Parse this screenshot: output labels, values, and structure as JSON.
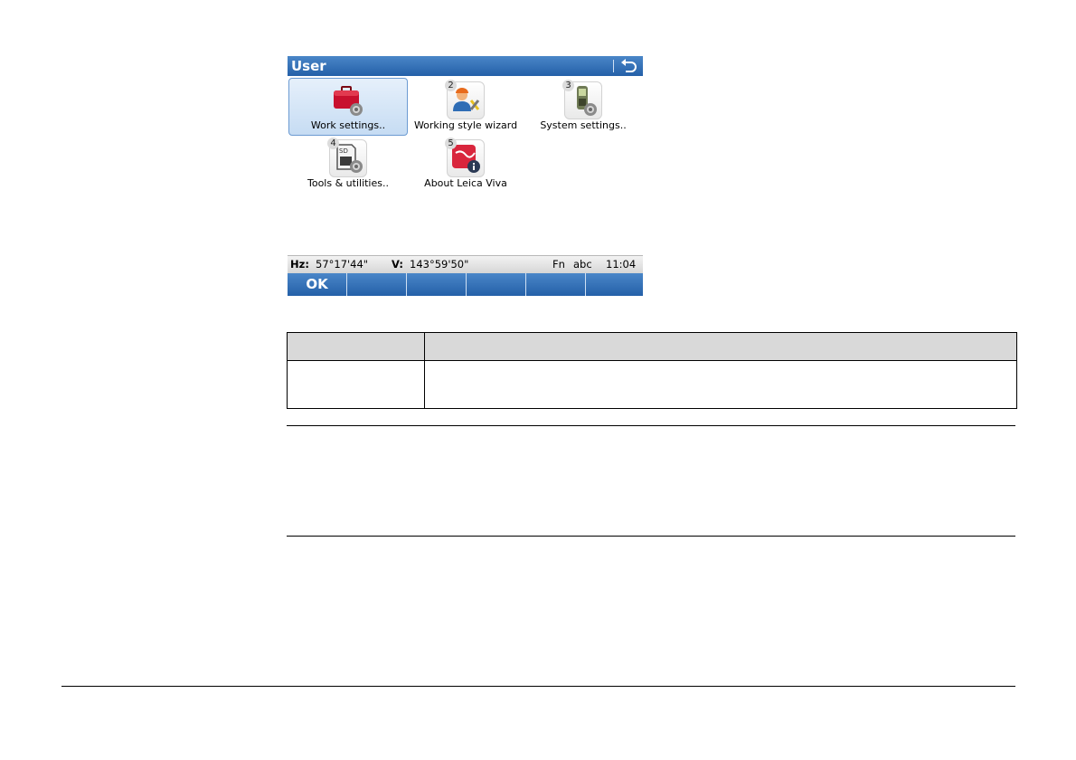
{
  "screen": {
    "title": "User",
    "back_icon": "back-arrow-icon",
    "tiles": [
      {
        "number": "",
        "label": "Work settings..",
        "icon": "briefcase-gear-icon",
        "selected": true
      },
      {
        "number": "2",
        "label": "Working style wizard",
        "icon": "user-wizard-icon",
        "selected": false
      },
      {
        "number": "3",
        "label": "System settings..",
        "icon": "instrument-gear-icon",
        "selected": false
      },
      {
        "number": "4",
        "label": "Tools & utilities..",
        "icon": "sd-card-gear-icon",
        "selected": false
      },
      {
        "number": "5",
        "label": "About Leica Viva",
        "icon": "viva-info-icon",
        "selected": false
      }
    ],
    "status": {
      "hz_label": "Hz:",
      "hz_value": "57°17'44\"",
      "v_label": "V:",
      "v_value": "143°59'50\"",
      "fn": "Fn",
      "input_mode": "abc",
      "time": "11:04"
    },
    "softkeys": [
      "OK",
      "",
      "",
      "",
      "",
      ""
    ]
  },
  "colors": {
    "bar_blue": "#2f6db5",
    "selection": "#c6dcf3",
    "table_header": "#d9d9d9"
  }
}
